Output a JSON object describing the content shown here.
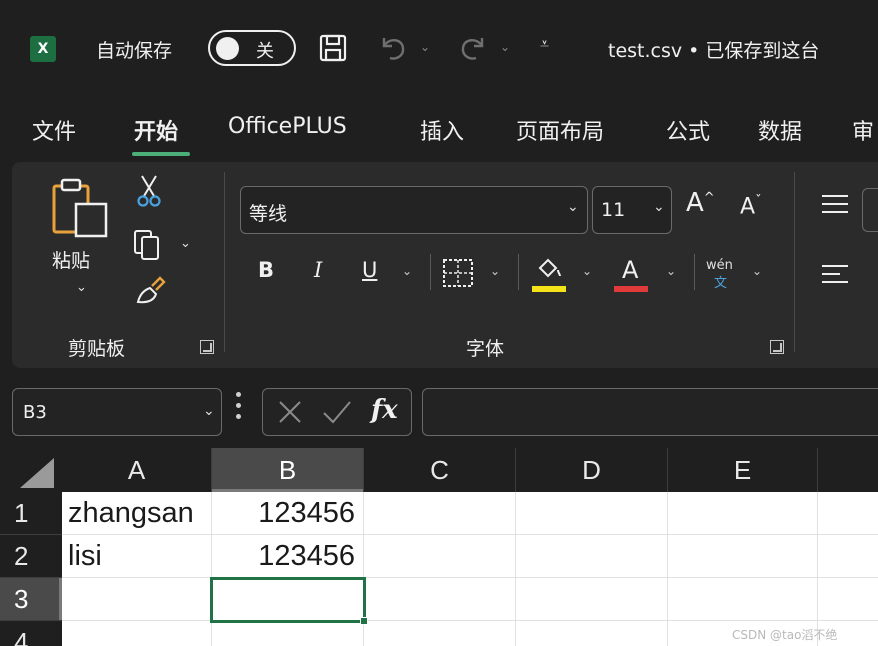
{
  "app": {
    "logo_letter": "X",
    "autosave_label": "自动保存",
    "autosave_state": "关",
    "document_title": "test.csv • 已保存到这台"
  },
  "tabs": [
    "文件",
    "开始",
    "OfficePLUS",
    "插入",
    "页面布局",
    "公式",
    "数据",
    "审"
  ],
  "active_tab_index": 1,
  "clipboard_group": {
    "paste_label": "粘贴",
    "group_label": "剪贴板"
  },
  "font_group": {
    "font_name": "等线",
    "font_size": "11",
    "grow_label": "A",
    "shrink_label": "A",
    "bold": "B",
    "italic": "I",
    "underline": "U",
    "font_color_letter": "A",
    "phonetic_top": "wén",
    "phonetic_bottom": "文",
    "group_label": "字体",
    "fill_color": "#f5e31a",
    "font_color": "#e03a3a"
  },
  "formula_bar": {
    "name_box": "B3",
    "fx_label": "fx",
    "formula": ""
  },
  "sheet": {
    "columns": [
      "A",
      "B",
      "C",
      "D",
      "E"
    ],
    "selected_column": "B",
    "rows": [
      "1",
      "2",
      "3",
      "4"
    ],
    "selected_row": "3",
    "cells": {
      "A1": "zhangsan",
      "B1": "123456",
      "A2": "lisi",
      "B2": "123456"
    },
    "active_cell": "B3",
    "accent_color": "#217346"
  },
  "watermark": "CSDN @tao滔不绝"
}
